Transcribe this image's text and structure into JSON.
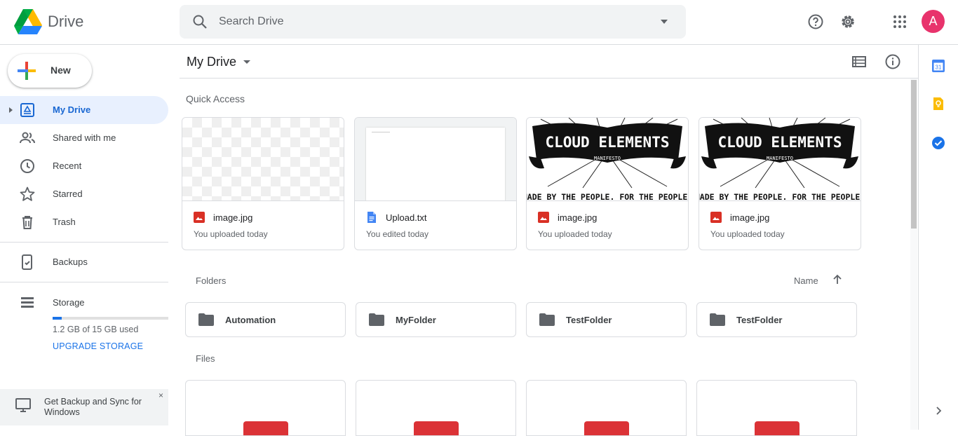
{
  "header": {
    "app_name": "Drive",
    "search_placeholder": "Search Drive",
    "avatar_initial": "A",
    "icons": [
      "help-icon",
      "settings-icon",
      "apps-grid-icon"
    ]
  },
  "sidebar": {
    "new_label": "New",
    "items": [
      {
        "label": "My Drive",
        "icon": "my-drive-icon",
        "active": true
      },
      {
        "label": "Shared with me",
        "icon": "shared-icon"
      },
      {
        "label": "Recent",
        "icon": "clock-icon"
      },
      {
        "label": "Starred",
        "icon": "star-icon"
      },
      {
        "label": "Trash",
        "icon": "trash-icon"
      }
    ],
    "backups_label": "Backups",
    "storage_label": "Storage",
    "storage_used_fraction": 0.08,
    "storage_text": "1.2 GB of 15 GB used",
    "upgrade_label": "UPGRADE STORAGE",
    "banner_text": "Get Backup and Sync for Windows",
    "banner_close": "×"
  },
  "main": {
    "title": "My Drive",
    "quick_access_label": "Quick Access",
    "quick_access": [
      {
        "name": "image.jpg",
        "sub": "You uploaded today",
        "type": "image",
        "thumb": "checker"
      },
      {
        "name": "Upload.txt",
        "sub": "You edited today",
        "type": "doc",
        "thumb": "doc"
      },
      {
        "name": "image.jpg",
        "sub": "You uploaded today",
        "type": "image",
        "thumb": "cloud"
      },
      {
        "name": "image.jpg",
        "sub": "You uploaded today",
        "type": "image",
        "thumb": "cloud"
      }
    ],
    "thumb_text": {
      "banner_title": "CLOUD ELEMENTS",
      "banner_sub": "MANIFESTO",
      "tagline": "MADE BY THE PEOPLE. FOR THE PEOPLE."
    },
    "folders_label": "Folders",
    "sort_label": "Name",
    "folders": [
      "Automation",
      "MyFolder",
      "TestFolder",
      "TestFolder"
    ],
    "files_label": "Files"
  },
  "colors": {
    "accent": "#1a73e8",
    "active_bg": "#e8f0fe",
    "avatar": "#e8336c",
    "image_icon": "#d93025",
    "doc_icon": "#4285f4"
  }
}
